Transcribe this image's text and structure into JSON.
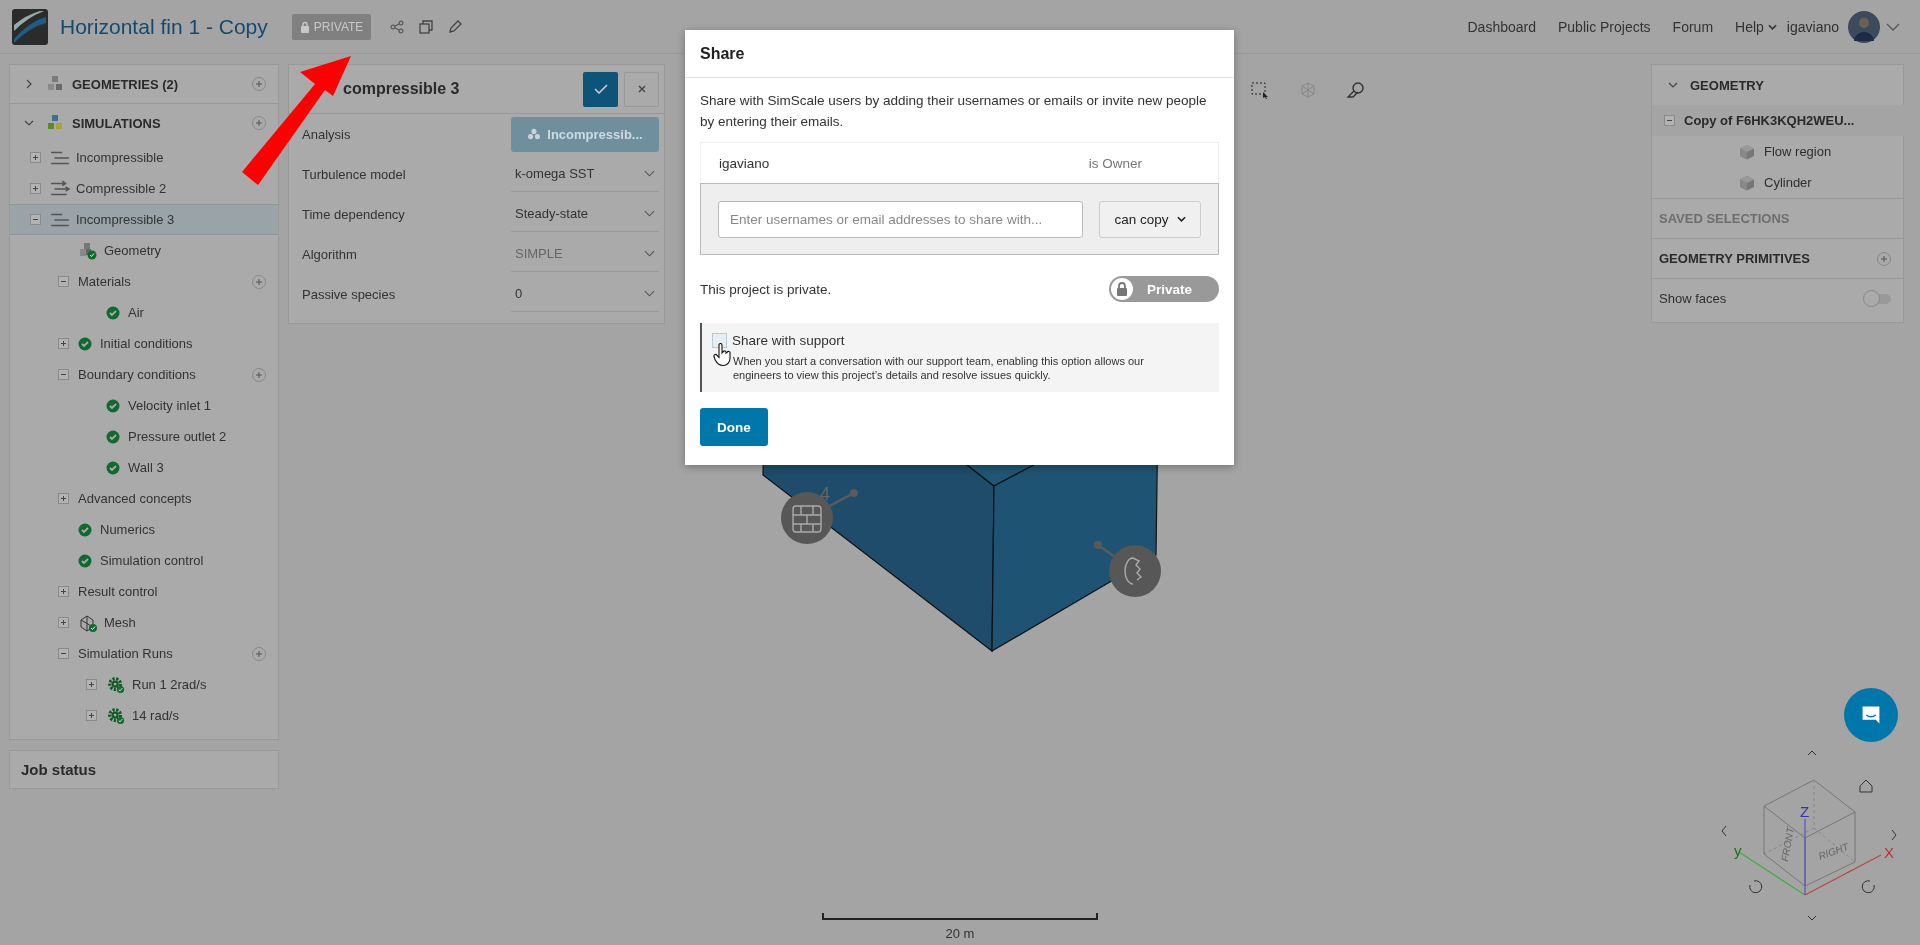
{
  "header": {
    "title": "Horizontal fin 1 - Copy",
    "badge": "PRIVATE",
    "nav": [
      {
        "label": "Dashboard",
        "kind": "link"
      },
      {
        "label": "Public Projects",
        "kind": "link"
      },
      {
        "label": "Forum",
        "kind": "link"
      },
      {
        "label": "Help",
        "kind": "menu"
      }
    ],
    "user": "igaviano"
  },
  "sidebar": {
    "sections": [
      {
        "label": "GEOMETRIES (2)",
        "kind": "geometries",
        "expanded": false,
        "add": true
      },
      {
        "label": "SIMULATIONS",
        "kind": "simulations",
        "expanded": true,
        "add": true,
        "items": [
          {
            "label": "Incompressible",
            "kind": "incompressible",
            "expanded": false,
            "selected": false
          },
          {
            "label": "Compressible 2",
            "kind": "compressible",
            "expanded": false,
            "selected": false
          },
          {
            "label": "Incompressible 3",
            "kind": "incompressible",
            "expanded": true,
            "selected": true,
            "children": [
              {
                "label": "Geometry",
                "kind": "geometry",
                "done": true
              },
              {
                "label": "Materials",
                "kind": "plain",
                "expanded": true,
                "add": true,
                "children": [
                  {
                    "label": "Air",
                    "kind": "status",
                    "done": true
                  }
                ]
              },
              {
                "label": "Initial conditions",
                "kind": "status",
                "done": true,
                "expanded": false
              },
              {
                "label": "Boundary conditions",
                "kind": "plain",
                "expanded": true,
                "add": true,
                "children": [
                  {
                    "label": "Velocity inlet 1",
                    "kind": "status",
                    "done": true
                  },
                  {
                    "label": "Pressure outlet 2",
                    "kind": "status",
                    "done": true
                  },
                  {
                    "label": "Wall 3",
                    "kind": "status",
                    "done": true
                  }
                ]
              },
              {
                "label": "Advanced concepts",
                "kind": "plain",
                "expanded": false
              },
              {
                "label": "Numerics",
                "kind": "status",
                "done": true
              },
              {
                "label": "Simulation control",
                "kind": "status",
                "done": true
              },
              {
                "label": "Result control",
                "kind": "plain",
                "expanded": false
              },
              {
                "label": "Mesh",
                "kind": "mesh",
                "done": true,
                "expanded": false
              },
              {
                "label": "Simulation Runs",
                "kind": "plain",
                "expanded": true,
                "add": true,
                "children": [
                  {
                    "label": "Run 1 2rad/s",
                    "kind": "run",
                    "done": true,
                    "expanded": false
                  },
                  {
                    "label": "14 rad/s",
                    "kind": "run",
                    "done": true,
                    "expanded": false
                  }
                ]
              }
            ]
          }
        ]
      }
    ],
    "job_status": "Job status"
  },
  "settings": {
    "title": "compressible 3",
    "fields": [
      {
        "label": "Analysis",
        "kind": "button",
        "value": "Incompressib...",
        "disabled": false
      },
      {
        "label": "Turbulence model",
        "kind": "select",
        "value": "k-omega SST",
        "disabled": false
      },
      {
        "label": "Time dependency",
        "kind": "select",
        "value": "Steady-state",
        "disabled": false
      },
      {
        "label": "Algorithm",
        "kind": "select",
        "value": "SIMPLE",
        "disabled": true
      },
      {
        "label": "Passive species",
        "kind": "select",
        "value": "0",
        "disabled": false
      }
    ]
  },
  "viewport": {
    "markers": [
      {
        "kind": "wall",
        "label": "4"
      },
      {
        "kind": "outlet"
      }
    ],
    "scale": "20 m",
    "view_cube": {
      "axes": [
        "Z",
        "y",
        "X"
      ],
      "faces": [
        "FRONT",
        "RIGHT"
      ]
    }
  },
  "geometry_panel": {
    "title": "GEOMETRY",
    "expanded": true,
    "root": {
      "label": "Copy of F6HK3KQH2WEU...",
      "expanded": true,
      "children": [
        {
          "label": "Flow region"
        },
        {
          "label": "Cylinder"
        }
      ]
    },
    "sections": [
      {
        "label": "SAVED SELECTIONS",
        "disabled": true,
        "add": false
      },
      {
        "label": "GEOMETRY PRIMITIVES",
        "disabled": false,
        "add": true
      }
    ],
    "show_faces": {
      "label": "Show faces",
      "on": false
    }
  },
  "share_dialog": {
    "title": "Share",
    "description": "Share with SimScale users by adding their usernames or emails or invite new people by entering their emails.",
    "members": [
      {
        "name": "igaviano",
        "role": "is Owner"
      }
    ],
    "invite": {
      "placeholder": "Enter usernames or email addresses to share with...",
      "permission": "can copy"
    },
    "visibility": {
      "text": "This project is private.",
      "label": "Private",
      "public": false
    },
    "support": {
      "label": "Share with support",
      "checked": false,
      "description": "When you start a conversation with our support team, enabling this option allows our engineers to view this project’s details and resolve issues quickly."
    },
    "done": "Done"
  }
}
